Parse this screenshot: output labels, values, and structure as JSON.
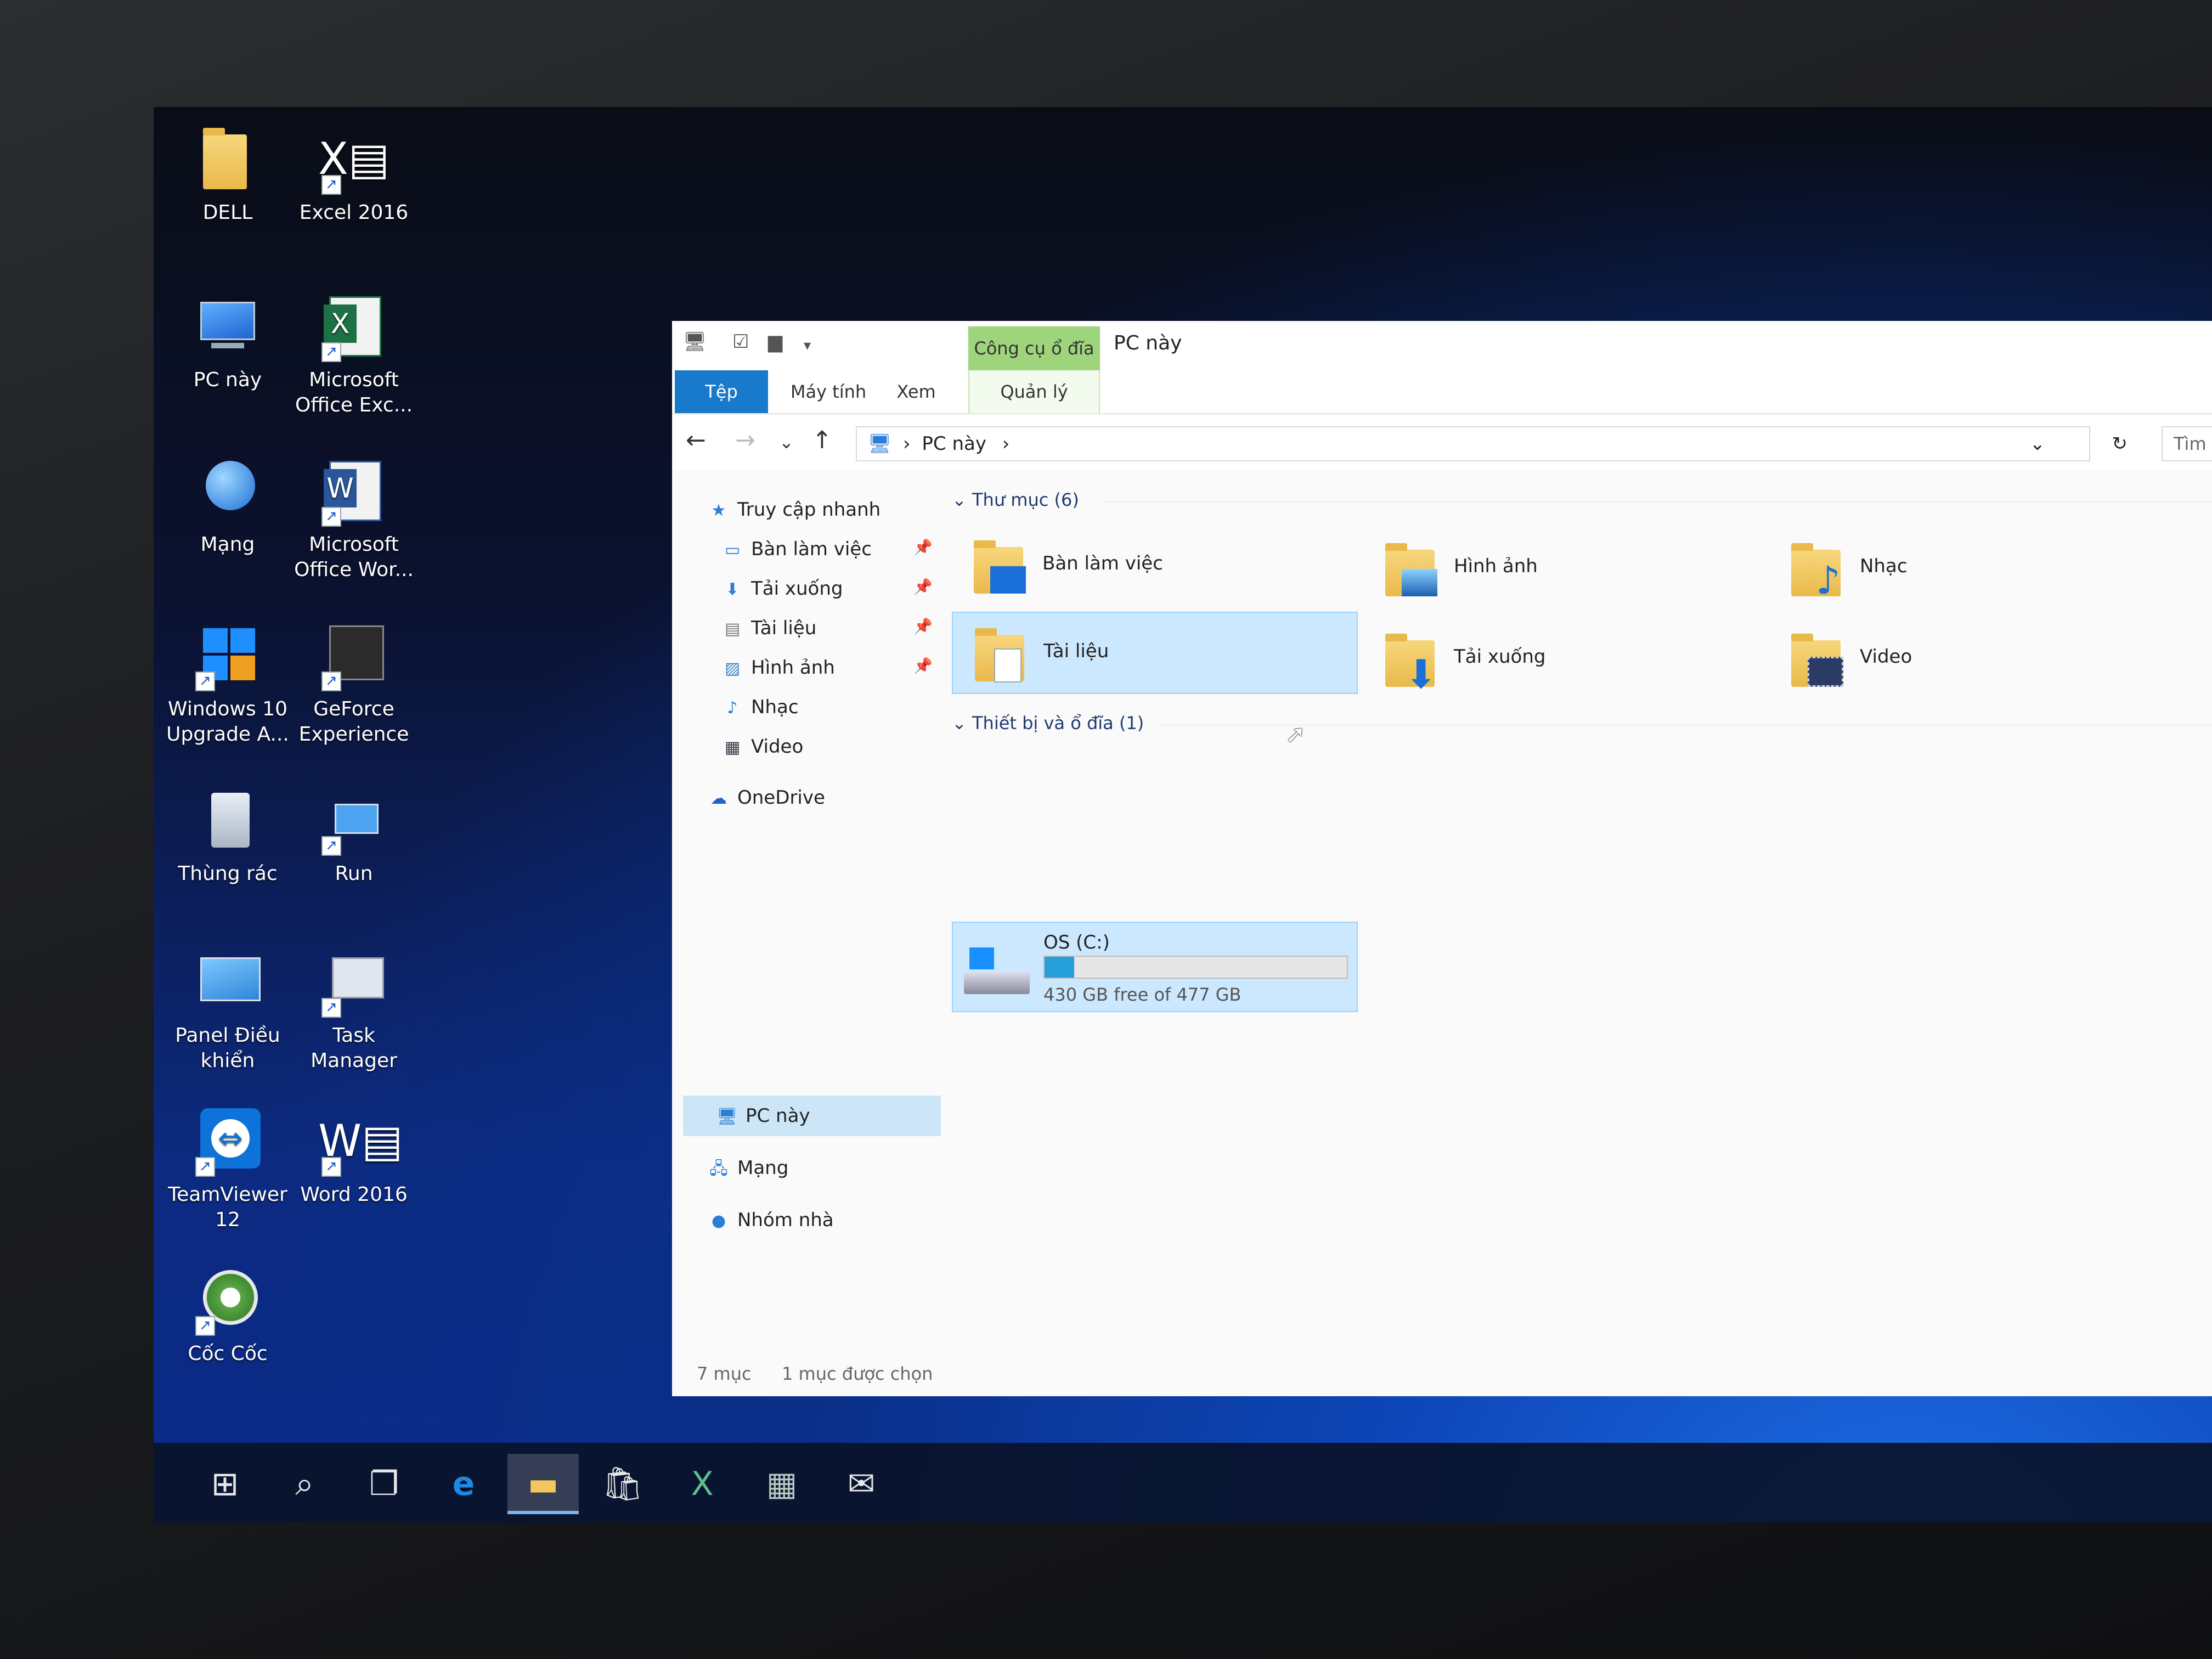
{
  "desktop": {
    "icons": [
      {
        "label": "DELL",
        "icon": "user-folder-icon"
      },
      {
        "label": "Excel 2016",
        "icon": "excel-icon"
      },
      {
        "label": "PC này",
        "icon": "computer-icon"
      },
      {
        "label": "Microsoft Office Exc...",
        "icon": "excel-icon"
      },
      {
        "label": "Mạng",
        "icon": "network-icon"
      },
      {
        "label": "Microsoft Office Wor...",
        "icon": "word-icon"
      },
      {
        "label": "Windows 10 Upgrade A...",
        "icon": "windows-icon"
      },
      {
        "label": "GeForce Experience",
        "icon": "nvidia-icon"
      },
      {
        "label": "Thùng rác",
        "icon": "recycle-bin-icon"
      },
      {
        "label": "Run",
        "icon": "run-icon"
      },
      {
        "label": "Panel Điều khiển",
        "icon": "control-panel-icon"
      },
      {
        "label": "Task Manager",
        "icon": "task-manager-icon"
      },
      {
        "label": "TeamViewer 12",
        "icon": "teamviewer-icon"
      },
      {
        "label": "Word 2016",
        "icon": "word-icon"
      },
      {
        "label": "Cốc Cốc",
        "icon": "coccoc-browser-icon"
      }
    ]
  },
  "explorer": {
    "context_tab": "Công cụ ổ đĩa",
    "title": "PC này",
    "ribbon_tabs": [
      "Tệp",
      "Máy tính",
      "Xem",
      "Quản lý"
    ],
    "address": {
      "crumb": "PC này"
    },
    "search_placeholder": "Tìm kiếm PC này",
    "nav": {
      "quick_access": "Truy cập nhanh",
      "quick_items": [
        "Bàn làm việc",
        "Tải xuống",
        "Tài liệu",
        "Hình ảnh",
        "Nhạc",
        "Video"
      ],
      "onedrive": "OneDrive",
      "this_pc": "PC này",
      "network": "Mạng",
      "homegroup": "Nhóm nhà"
    },
    "folders_header": "Thư mục (6)",
    "folders": [
      "Bàn làm việc",
      "Hình ảnh",
      "Nhạc",
      "Tài liệu",
      "Tải xuống",
      "Video"
    ],
    "devices_header": "Thiết bị và ổ đĩa (1)",
    "drive": {
      "name": "OS (C:)",
      "free_text": "430 GB free of 477 GB",
      "used_fraction": 0.0985
    },
    "status": {
      "count": "7 mục",
      "selected": "1 mục được chọn"
    }
  },
  "taskbar": {
    "items": [
      "start-icon",
      "search-icon",
      "task-view-icon",
      "edge-icon",
      "file-explorer-icon",
      "store-icon",
      "excel-icon",
      "excel-icon",
      "mail-icon"
    ]
  },
  "colors": {
    "accent": "#1979ca",
    "selection": "#cce8ff",
    "context_tab": "#9ed47b"
  }
}
